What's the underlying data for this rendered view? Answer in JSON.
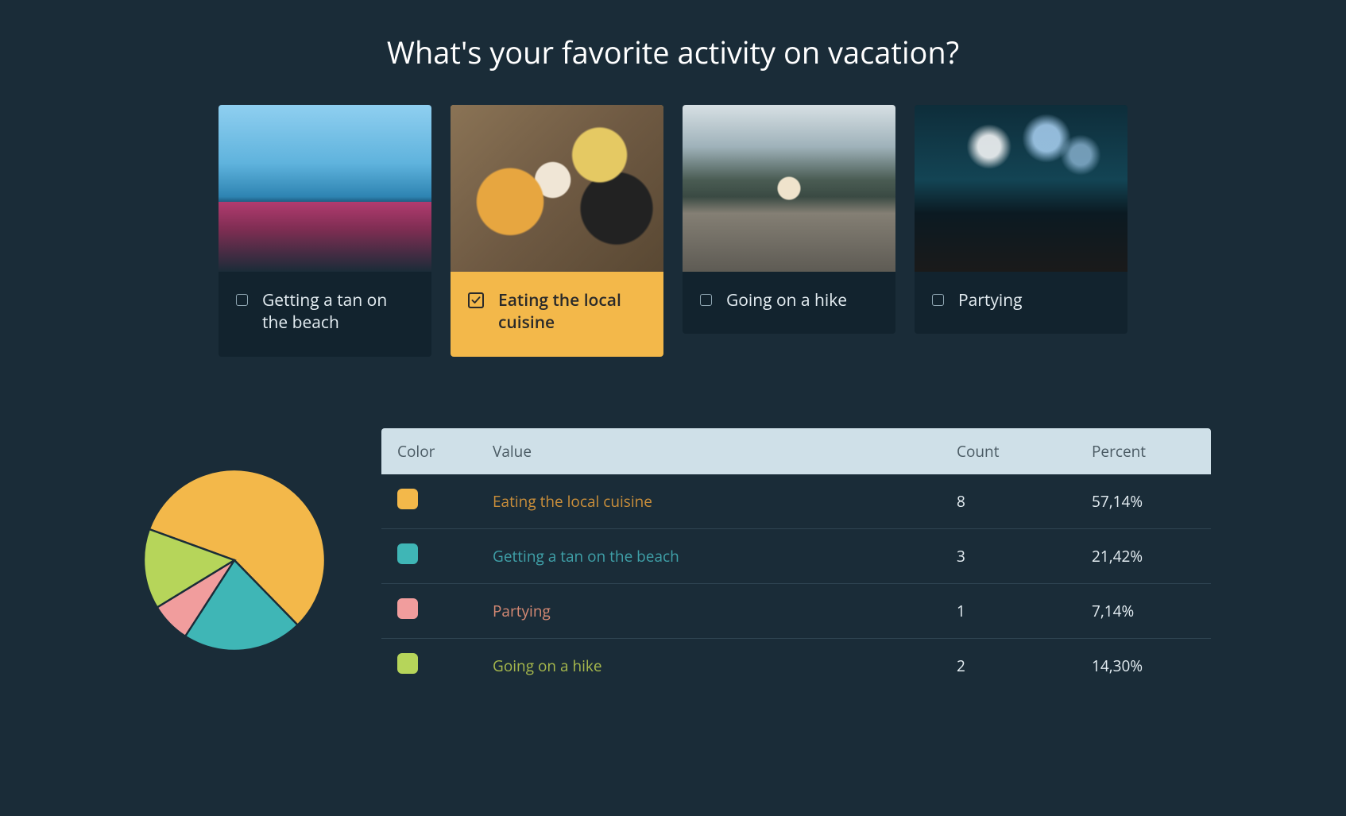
{
  "title": "What's your favorite activity on vacation?",
  "options": [
    {
      "label": "Getting a tan on the beach",
      "selected": false,
      "thumb": "beach"
    },
    {
      "label": "Eating the local cuisine",
      "selected": true,
      "thumb": "food"
    },
    {
      "label": "Going on a hike",
      "selected": false,
      "thumb": "hike"
    },
    {
      "label": "Partying",
      "selected": false,
      "thumb": "party"
    }
  ],
  "colors": {
    "yellow": "#f3b84a",
    "teal": "#3fb6b6",
    "pink": "#f19d9d",
    "green": "#b6d55a"
  },
  "table": {
    "headers": {
      "color": "Color",
      "value": "Value",
      "count": "Count",
      "percent": "Percent"
    },
    "rows": [
      {
        "color_key": "yellow",
        "value": "Eating the local cuisine",
        "value_color": "#c98e3a",
        "count": 8,
        "percent": "57,14%"
      },
      {
        "color_key": "teal",
        "value": "Getting a tan on the beach",
        "value_color": "#3fa0a8",
        "count": 3,
        "percent": "21,42%"
      },
      {
        "color_key": "pink",
        "value": "Partying",
        "value_color": "#d68a74",
        "count": 1,
        "percent": "7,14%"
      },
      {
        "color_key": "green",
        "value": "Going on a hike",
        "value_color": "#a6b84c",
        "count": 2,
        "percent": "14,30%"
      }
    ]
  },
  "chart_data": {
    "type": "pie",
    "title": "What's your favorite activity on vacation?",
    "categories": [
      "Eating the local cuisine",
      "Getting a tan on the beach",
      "Partying",
      "Going on a hike"
    ],
    "values": [
      8,
      3,
      1,
      2
    ],
    "percent": [
      57.14,
      21.42,
      7.14,
      14.3
    ],
    "series_colors": [
      "yellow",
      "teal",
      "pink",
      "green"
    ]
  }
}
